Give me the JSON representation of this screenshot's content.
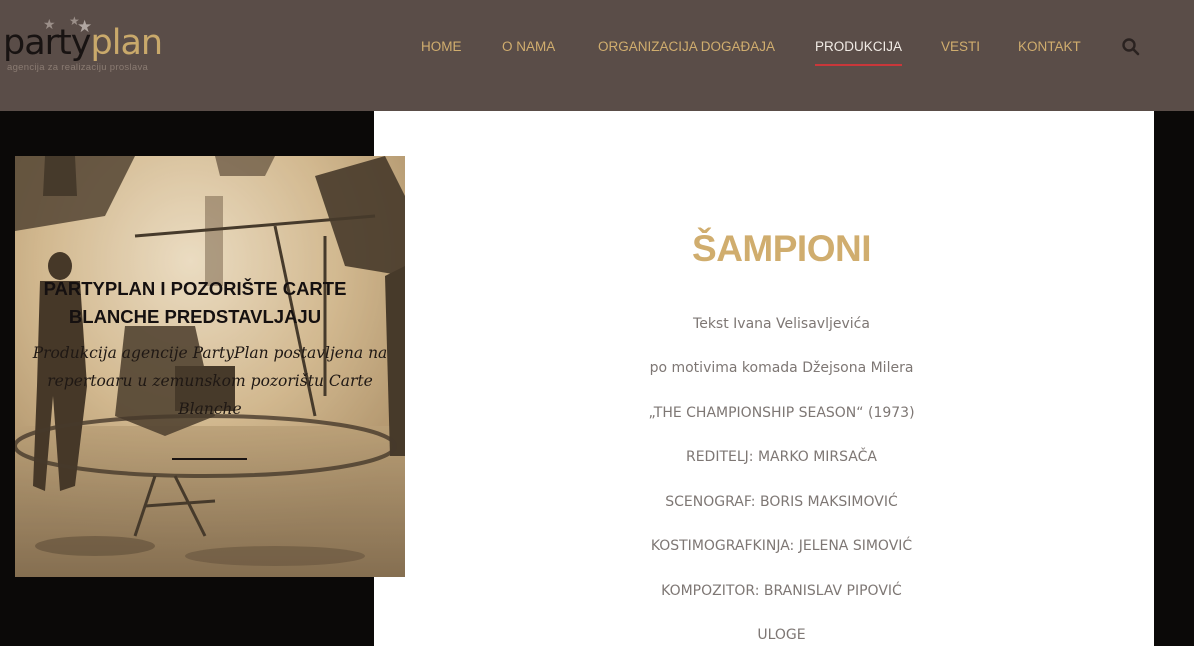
{
  "logo": {
    "word_dark": "party",
    "word_light": "plan",
    "tagline": "agencija za realizaciju proslava"
  },
  "nav": {
    "items": [
      {
        "label": "HOME",
        "active": false
      },
      {
        "label": "O NAMA",
        "active": false
      },
      {
        "label": "ORGANIZACIJA DOGAĐAJA",
        "active": false
      },
      {
        "label": "PRODUKCIJA",
        "active": true
      },
      {
        "label": "VESTI",
        "active": false
      },
      {
        "label": "KONTAKT",
        "active": false
      }
    ],
    "search_icon": "search-icon"
  },
  "hero": {
    "title": "PARTYPLAN I POZORIŠTE CARTE BLANCHE PREDSTAVLJAJU",
    "subtitle": "Produkcija agencije PartyPlan postavljena na repertoaru u zemunskom pozorištu Carte Blanche"
  },
  "content": {
    "title": "ŠAMPIONI",
    "credits": [
      "Tekst Ivana Velisavljevića",
      "po motivima komada Džejsona Milera",
      "„THE CHAMPIONSHIP SEASON“ (1973)",
      "REDITELJ: MARKO MIRSAČA",
      "SCENOGRAF: BORIS MAKSIMOVIĆ",
      "KOSTIMOGRAFKINJA: JELENA SIMOVIĆ",
      "KOMPOZITOR: BRANISLAV PIPOVIĆ",
      "ULOGE"
    ]
  },
  "colors": {
    "header_bg": "#5a4d48",
    "accent_gold": "#d0ad6e",
    "active_underline": "#c9373a",
    "page_bg": "#0b0908"
  }
}
